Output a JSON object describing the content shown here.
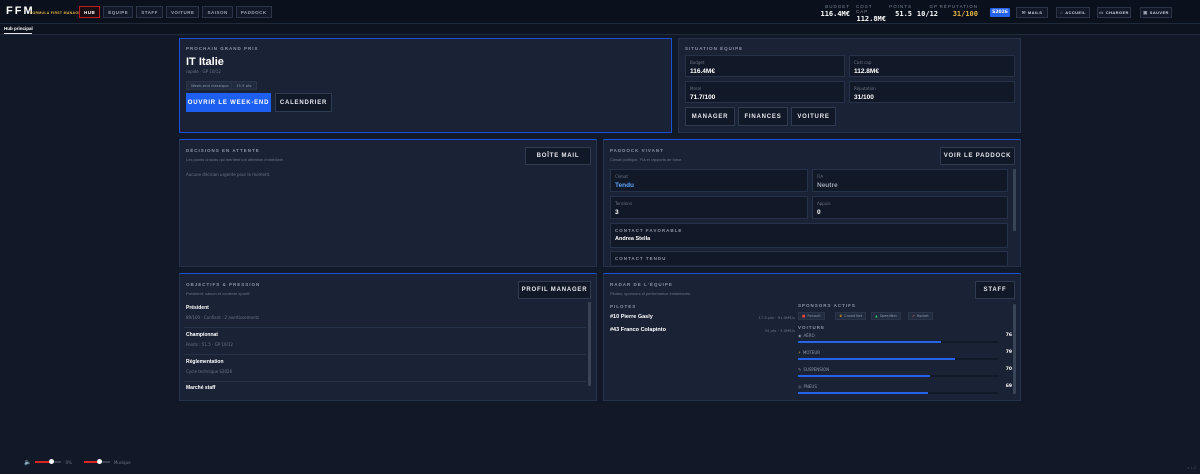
{
  "app": {
    "logo": "FFM",
    "logo_subtitle": "FORMULA FIRST MANAGER",
    "version": "v 1.2"
  },
  "nav": {
    "tabs": [
      {
        "label": "HUB",
        "active": true
      },
      {
        "label": "ÉQUIPE",
        "active": false
      },
      {
        "label": "STAFF",
        "active": false
      },
      {
        "label": "VOITURE",
        "active": false
      },
      {
        "label": "SAISON",
        "active": false
      },
      {
        "label": "PADDOCK",
        "active": false
      }
    ]
  },
  "stats": {
    "budget": {
      "label": "BUDGET",
      "value": "116.4M€"
    },
    "cost_cap": {
      "label": "COST CAP",
      "value": "112.8M€"
    },
    "points": {
      "label": "POINTS",
      "value": "51.5"
    },
    "gp": {
      "label": "GP",
      "value": "10/12"
    },
    "reputation": {
      "label": "RÉPUTATION",
      "value": "31/100"
    }
  },
  "season": "S2026",
  "top_buttons": {
    "mails": "MAILS",
    "accueil": "ACCUEIL",
    "charger": "CHARGER",
    "sauver": "SAUVER"
  },
  "subtab": "Hub principal",
  "next_gp": {
    "title": "PROCHAIN GRAND PRIX",
    "name": "IT Italie",
    "meta": "rapide · GP 10/12",
    "chips": [
      "Week-end classique",
      "15.5 pts"
    ],
    "open_button": "OUVRIR LE WEEK-END",
    "calendar_button": "CALENDRIER"
  },
  "team_situation": {
    "title": "SITUATION ÉQUIPE",
    "boxes": [
      {
        "label": "Budget",
        "value": "116.4M€"
      },
      {
        "label": "Cost cap",
        "value": "112.8M€"
      },
      {
        "label": "Moral",
        "value": "71.7/100"
      },
      {
        "label": "Réputation",
        "value": "31/100"
      }
    ],
    "buttons": [
      "MANAGER",
      "FINANCES",
      "VOITURE"
    ]
  },
  "decisions": {
    "title": "DÉCISIONS EN ATTENTE",
    "subtitle": "Les points chauds qui méritent ton attention immédiate.",
    "empty": "Aucune décision urgente pour le moment.",
    "button": "BOÎTE MAIL"
  },
  "paddock": {
    "title": "PADDOCK VIVANT",
    "subtitle": "Climat politique, FIA et rapports de force.",
    "button": "VOIR LE PADDOCK",
    "boxes": [
      {
        "label": "Climat",
        "value": "Tendu",
        "highlight": true
      },
      {
        "label": "FIA",
        "value": "Neutre",
        "highlight": false
      },
      {
        "label": "Tensions",
        "value": "3",
        "highlight": false
      },
      {
        "label": "Appuis",
        "value": "0",
        "highlight": false
      }
    ],
    "favorable_title": "CONTACT FAVORABLE",
    "favorable_name": "Andrea Stella",
    "tense_title": "CONTACT TENDU"
  },
  "objectives": {
    "title": "OBJECTIFS & PRESSION",
    "subtitle": "Président, saison et contexte sportif.",
    "button": "PROFIL MANAGER",
    "rows": [
      {
        "title": "Président",
        "sub": "89/100 · Confiant · 2 avertissements"
      },
      {
        "title": "Championnat",
        "sub": "Points : 51.5 · GP 10/12"
      },
      {
        "title": "Réglementation",
        "sub": "Cycle technique S2026"
      },
      {
        "title": "Marché staff",
        "sub": ""
      }
    ]
  },
  "team_radar": {
    "title": "RADAR DE L'ÉQUIPE",
    "subtitle": "Pilotes, sponsors et performance instantanée.",
    "button": "STAFF",
    "drivers_title": "PILOTES",
    "drivers": [
      {
        "name": "#10 Pierre Gasly",
        "info": "17.5 pts · 91.0M€/s"
      },
      {
        "name": "#43 Franco Colapinto",
        "info": "34 pts · 3.0M€/s"
      }
    ],
    "sponsors_title": "SPONSORS ACTIFS",
    "sponsors": [
      {
        "name": "Renault",
        "icon": "car-icon"
      },
      {
        "name": "Crowd Bet",
        "icon": "crown-icon"
      },
      {
        "name": "SpeedNet",
        "icon": "signal-icon"
      },
      {
        "name": "Rocket",
        "icon": "rocket-icon"
      }
    ],
    "car_title": "VOITURE",
    "car": [
      {
        "label": "AÉRO",
        "icon": "wind-icon",
        "value": 76
      },
      {
        "label": "MOTEUR",
        "icon": "bolt-icon",
        "value": 79
      },
      {
        "label": "SUSPENSION",
        "icon": "spring-icon",
        "value": 70
      },
      {
        "label": "PNEUS",
        "icon": "tire-icon",
        "value": 69
      }
    ]
  },
  "audio": {
    "music_value": 0.6,
    "music_label": "0%",
    "sfx_value": 0.6,
    "sfx_label": "Musique"
  },
  "colors": {
    "accent": "#1d5ff0",
    "alert": "#b91c1c",
    "gold": "#e4b343"
  }
}
